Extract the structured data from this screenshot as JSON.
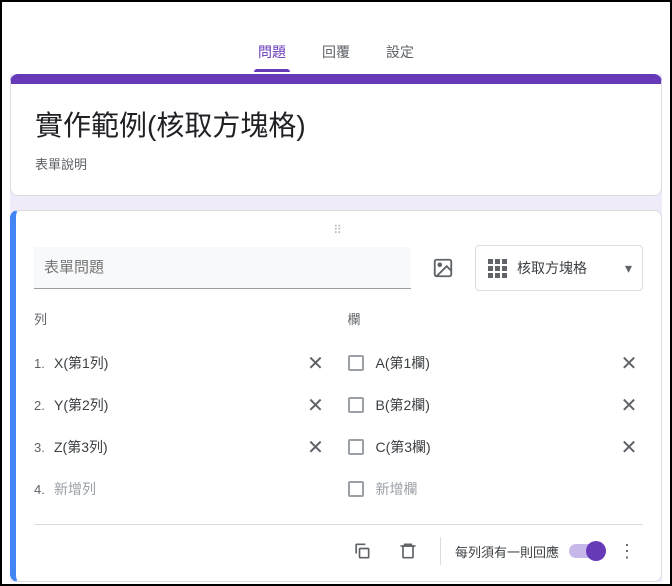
{
  "tabs": [
    "問題",
    "回覆",
    "設定"
  ],
  "form": {
    "title": "實作範例(核取方塊格)",
    "description": "表單說明"
  },
  "question": {
    "title_placeholder": "表單問題",
    "type_label": "核取方塊格",
    "rows_label": "列",
    "cols_label": "欄",
    "rows": [
      {
        "num": "1.",
        "text": "X(第1列)"
      },
      {
        "num": "2.",
        "text": "Y(第2列)"
      },
      {
        "num": "3.",
        "text": "Z(第3列)"
      }
    ],
    "add_row": {
      "num": "4.",
      "text": "新增列"
    },
    "cols": [
      {
        "text": "A(第1欄)"
      },
      {
        "text": "B(第2欄)"
      },
      {
        "text": "C(第3欄)"
      }
    ],
    "add_col": {
      "text": "新增欄"
    },
    "require_label": "每列須有一則回應",
    "require_on": true
  }
}
